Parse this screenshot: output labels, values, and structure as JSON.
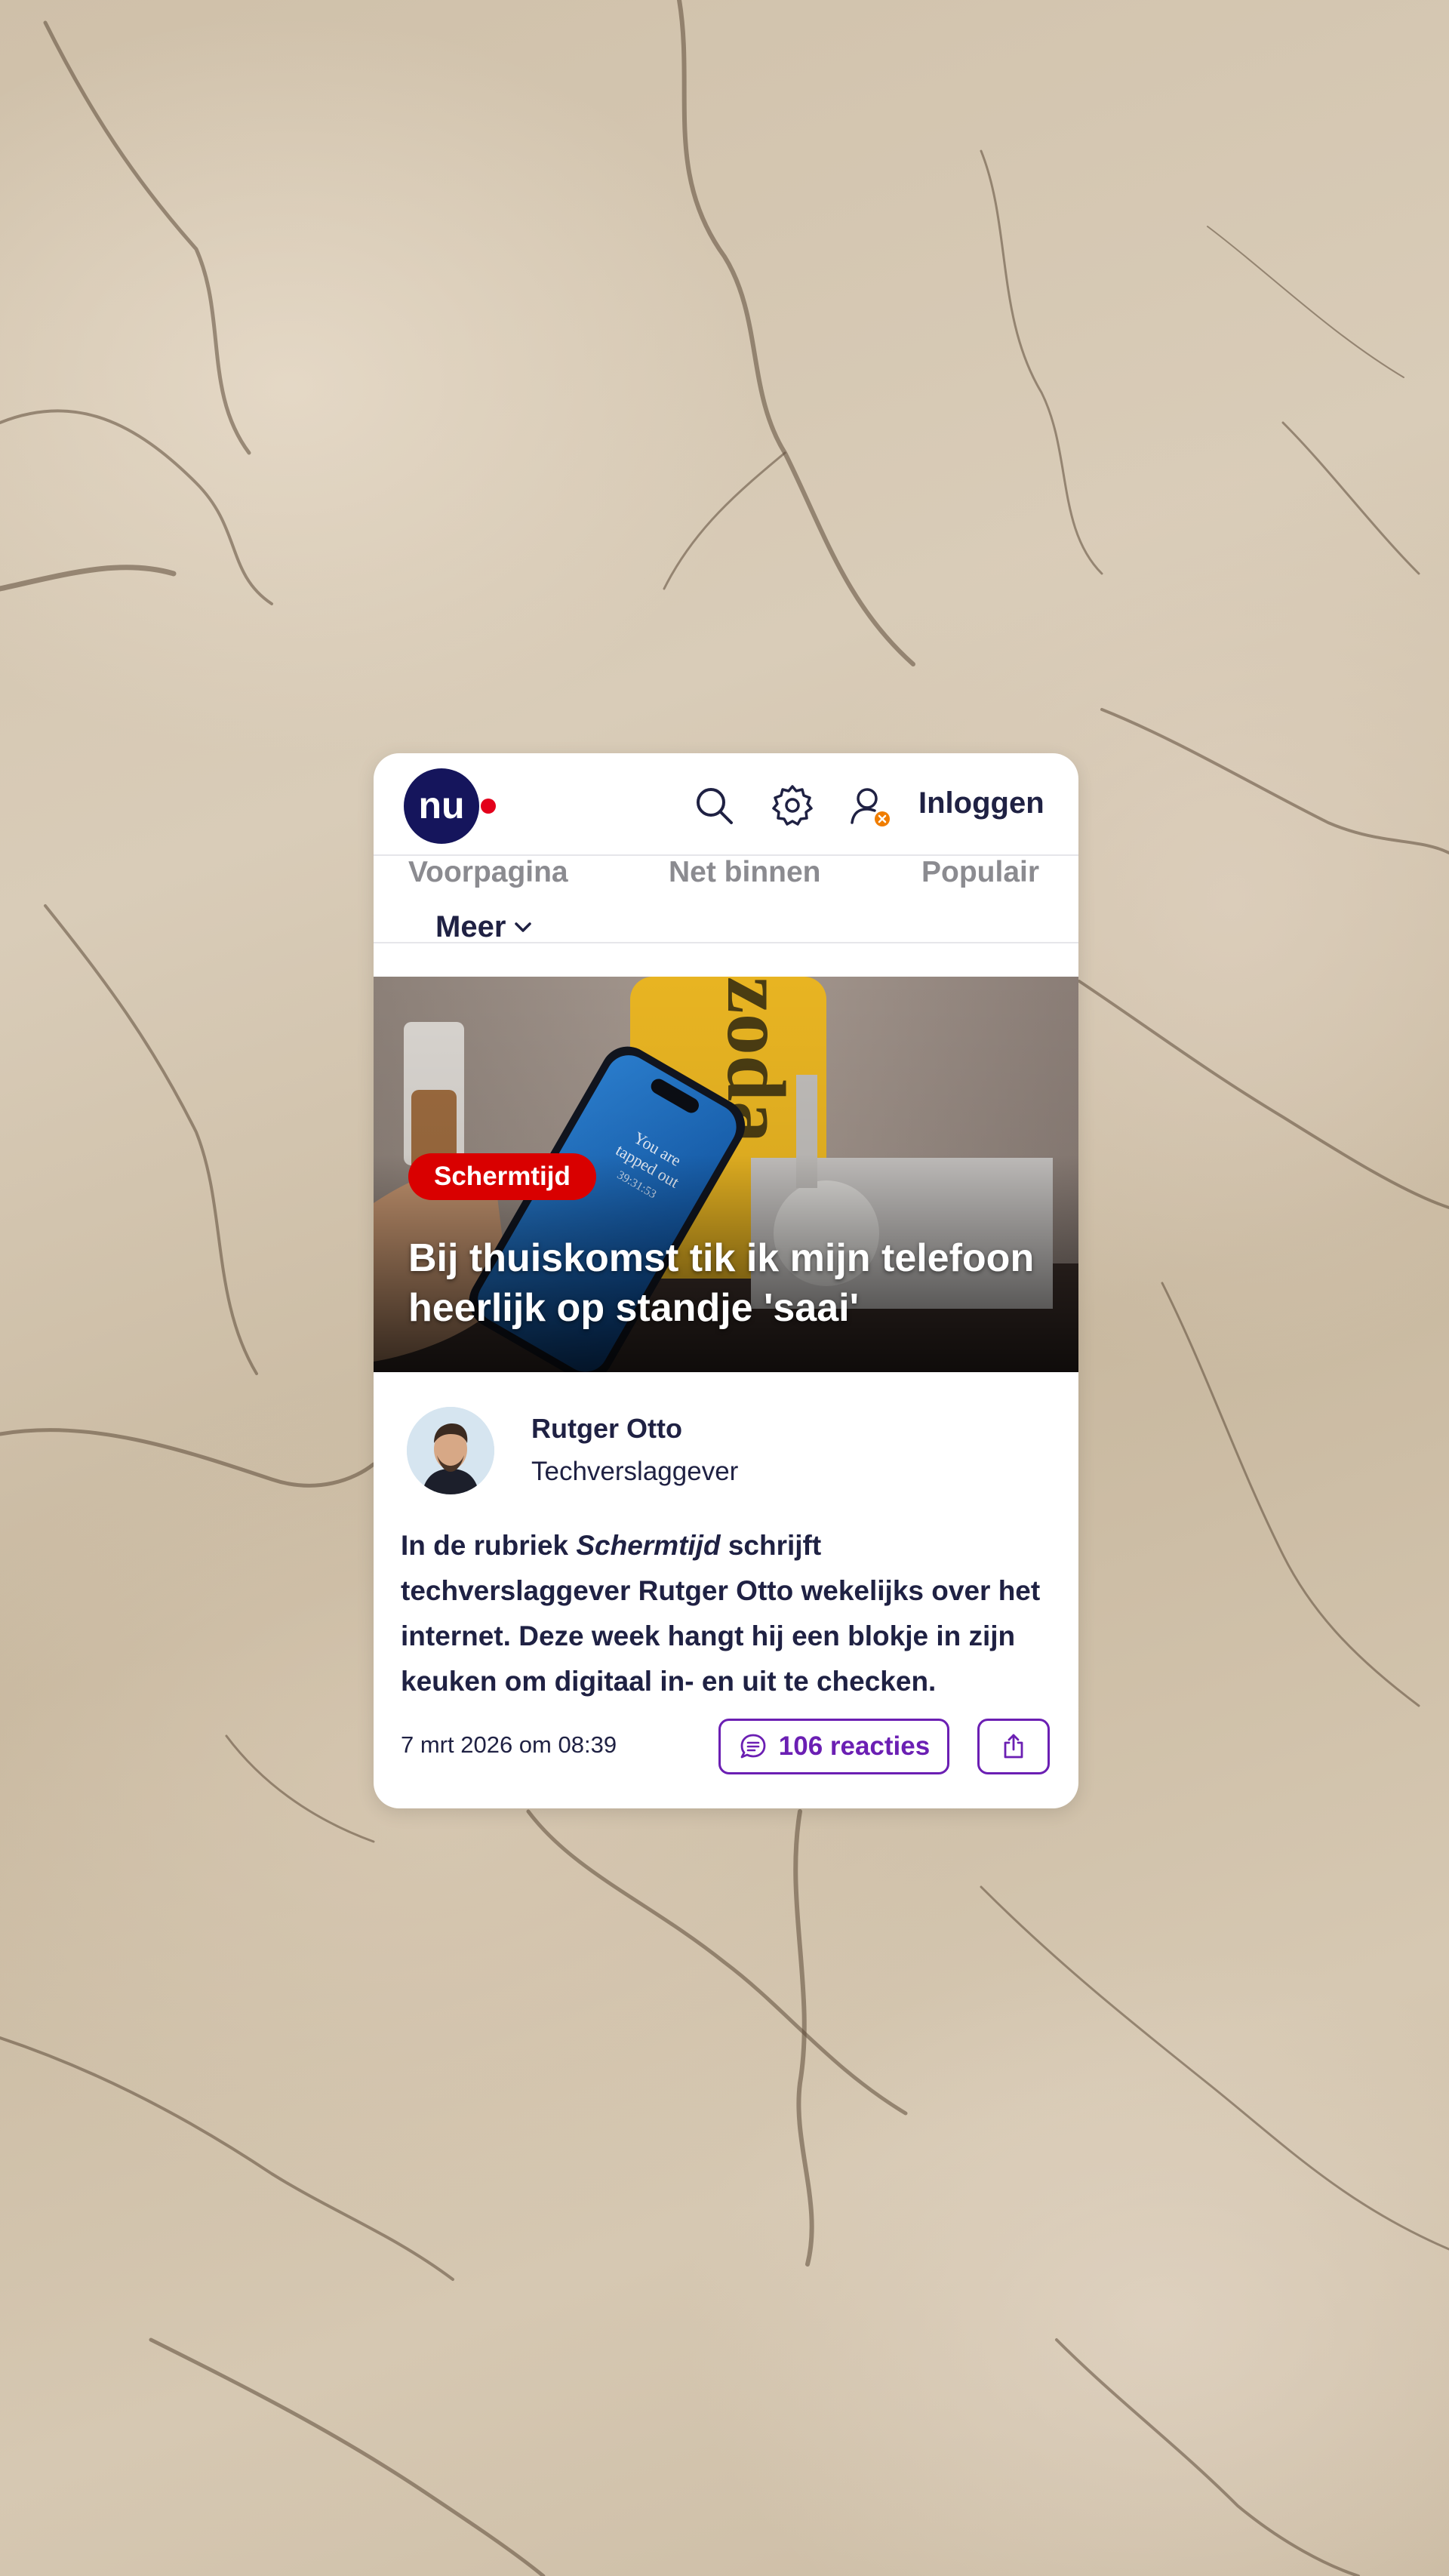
{
  "header": {
    "login_label": "Inloggen"
  },
  "nav": {
    "items": [
      {
        "label": "Voorpagina"
      },
      {
        "label": "Net binnen"
      },
      {
        "label": "Populair"
      }
    ],
    "more_label": "Meer"
  },
  "article": {
    "category": "Schermtijd",
    "title": "Bij thuiskomst tik ik mijn telefoon heerlijk op standje 'saai'",
    "author": {
      "name": "Rutger Otto",
      "role": "Techverslaggever"
    },
    "intro": {
      "before": "In de rubriek ",
      "emphasis": "Schermtijd",
      "after": " schrijft techverslaggever Rutger Otto wekelijks over het internet. Deze week hangt hij een blokje in zijn keuken om digitaal in- en uit te checken."
    },
    "date": "7 mrt 2026 om 08:39",
    "reactions_label": "106 reacties"
  },
  "colors": {
    "brand_navy": "#1f2143",
    "brand_red_dot": "#e3001b",
    "tag_red": "#d90000",
    "accent_purple": "#6b1fb3",
    "nav_inactive": "#8b8b90",
    "notification_orange": "#f07d00"
  },
  "icons": [
    "nu-logo",
    "search-icon",
    "settings-gear-icon",
    "user-icon",
    "chevron-down-icon",
    "comment-bubble-icon",
    "share-icon"
  ]
}
